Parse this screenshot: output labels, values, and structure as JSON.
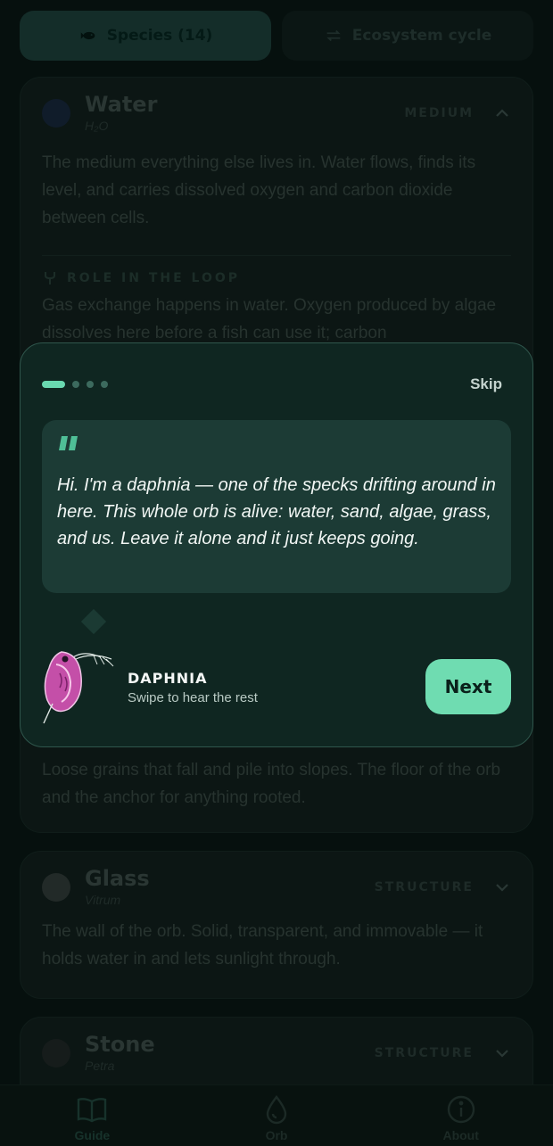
{
  "tabs": {
    "species_label": "Species (14)",
    "cycle_label": "Ecosystem cycle"
  },
  "cards": {
    "water": {
      "title": "Water",
      "subtitle": "H₂O",
      "tag": "MEDIUM",
      "description": "The medium everything else lives in. Water flows, finds its level, and carries dissolved oxygen and carbon dioxide between cells.",
      "role_heading": "ROLE IN THE LOOP",
      "role_text": "Gas exchange happens in water. Oxygen produced by algae dissolves here before a fish can use it; carbon",
      "dot_color": "#1a2a3a"
    },
    "sand": {
      "description": "Loose grains that fall and pile into slopes. The floor of the orb and the anchor for anything rooted."
    },
    "glass": {
      "title": "Glass",
      "subtitle": "Vitrum",
      "tag": "STRUCTURE",
      "description": "The wall of the orb. Solid, transparent, and immovable — it holds water in and lets sunlight through.",
      "dot_color": "#212927"
    },
    "stone": {
      "title": "Stone",
      "subtitle": "Petra",
      "tag": "STRUCTURE",
      "dot_color": "#161c1b"
    }
  },
  "onboarding": {
    "step": 1,
    "total_steps": 4,
    "skip_label": "Skip",
    "quote": "Hi. I'm a daphnia — one of the specks drifting around in here. This whole orb is alive: water, sand, algae, grass, and us. Leave it alone and it just keeps going.",
    "speaker_name": "DAPHNIA",
    "speaker_subtitle": "Swipe to hear the rest",
    "next_label": "Next",
    "accent_color": "#6fdcb1"
  },
  "nav": {
    "guide_label": "Guide",
    "orb_label": "Orb",
    "about_label": "About"
  }
}
